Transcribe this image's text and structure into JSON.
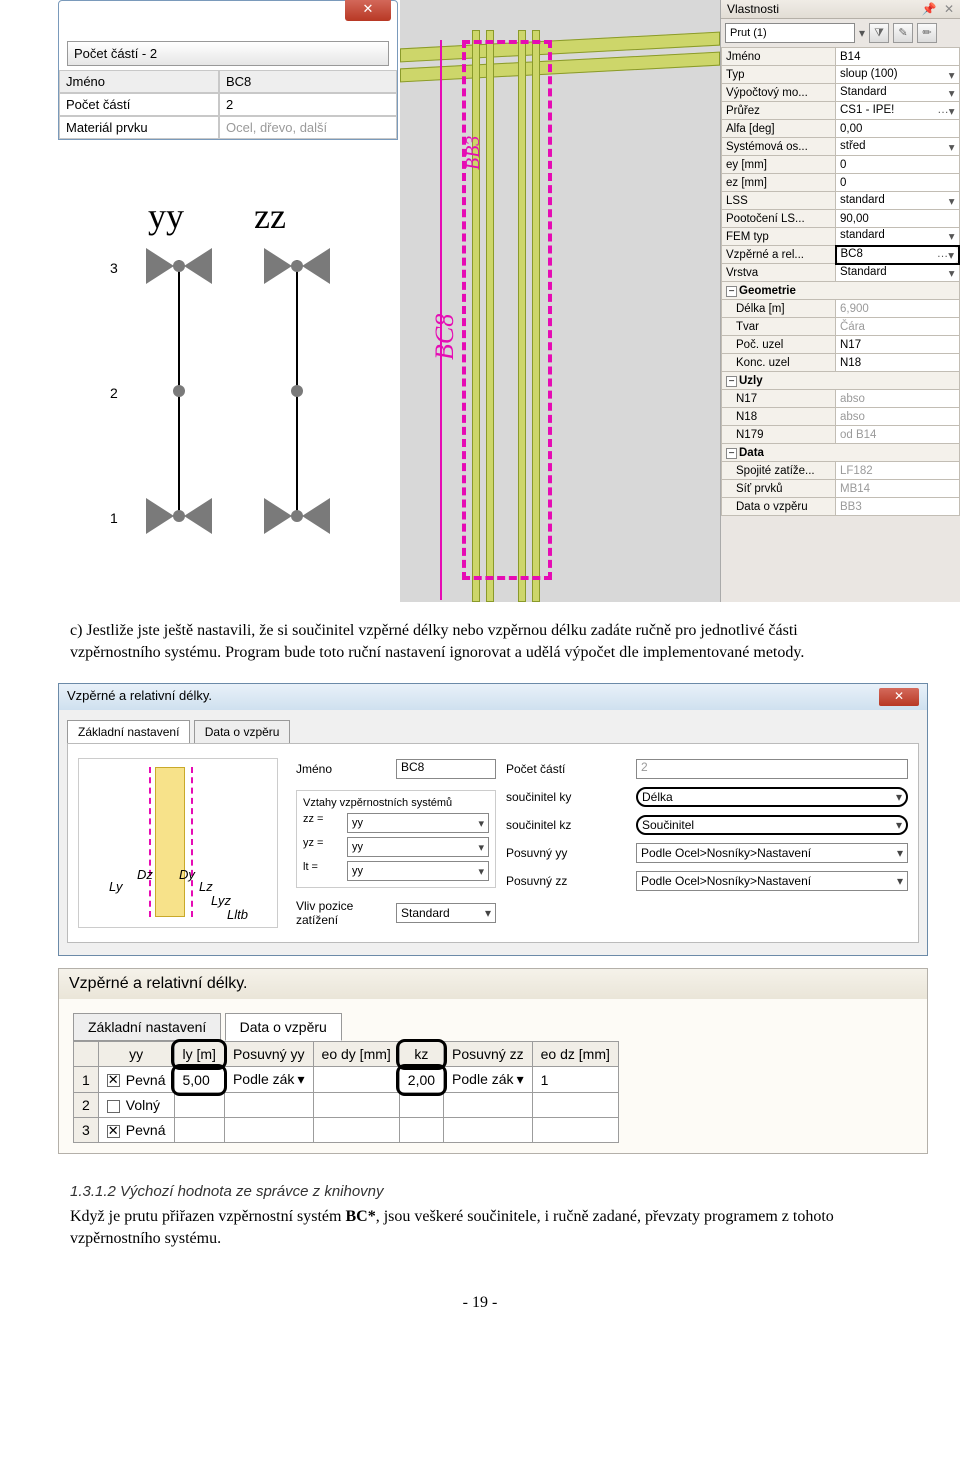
{
  "dialog_left": {
    "title": "Počet částí - 2",
    "rows": [
      {
        "label": "Jméno",
        "value": "BC8",
        "hdr": true
      },
      {
        "label": "Počet částí",
        "value": "2"
      },
      {
        "label": "Materiál prvku",
        "value": "Ocel, dřevo, další",
        "muted": true
      }
    ]
  },
  "yyzz": {
    "yy": "yy",
    "zz": "zz",
    "n1": "1",
    "n2": "2",
    "n3": "3"
  },
  "mid": {
    "label_bc8": "BC8",
    "label_bb3": "BB3"
  },
  "props": {
    "title": "Vlastnosti",
    "combo": "Prut (1)",
    "rows": [
      {
        "l": "Jméno",
        "v": "B14"
      },
      {
        "l": "Typ",
        "v": "sloup (100)",
        "dd": true
      },
      {
        "l": "Výpočtový mo...",
        "v": "Standard",
        "dd": true
      },
      {
        "l": "Průřez",
        "v": "CS1 - IPE!",
        "dd": true,
        "dots": true
      },
      {
        "l": "Alfa [deg]",
        "v": "0,00"
      },
      {
        "l": "Systémová os...",
        "v": "střed",
        "dd": true
      },
      {
        "l": "ey [mm]",
        "v": "0"
      },
      {
        "l": "ez [mm]",
        "v": "0"
      },
      {
        "l": "LSS",
        "v": "standard",
        "dd": true
      },
      {
        "l": "Pootočení LS...",
        "v": "90,00"
      },
      {
        "l": "FEM typ",
        "v": "standard",
        "dd": true
      },
      {
        "l": "Vzpěrné a rel...",
        "v": "BC8",
        "dd": true,
        "dots": true,
        "hl": true
      },
      {
        "l": "Vrstva",
        "v": "Standard",
        "dd": true
      }
    ],
    "sections": [
      {
        "l": "Geometrie",
        "rows": [
          {
            "l": "Délka [m]",
            "v": "6,900",
            "gray": true
          },
          {
            "l": "Tvar",
            "v": "Čára",
            "gray": true
          },
          {
            "l": "Poč. uzel",
            "v": "N17"
          },
          {
            "l": "Konc. uzel",
            "v": "N18"
          }
        ]
      },
      {
        "l": "Uzly",
        "rows": [
          {
            "l": "N17",
            "v": "abso",
            "gray": true
          },
          {
            "l": "N18",
            "v": "abso",
            "gray": true
          },
          {
            "l": "N179",
            "v": "od B14",
            "gray": true
          }
        ]
      },
      {
        "l": "Data",
        "rows": [
          {
            "l": "Spojité zatíže...",
            "v": "LF182",
            "gray": true
          },
          {
            "l": "Síť prvků",
            "v": "MB14",
            "gray": true
          },
          {
            "l": "Data o vzpěru",
            "v": "BB3",
            "gray": true
          }
        ]
      }
    ]
  },
  "doc": {
    "para_c": "c) Jestliže jste ještě nastavili, že si součinitel vzpěrné délky nebo vzpěrnou délku zadáte ručně pro jednotlivé části vzpěrnostního systému. Program bude toto ruční nastavení ignorovat a udělá výpočet dle implementované metody.",
    "sec_head": "1.3.1.2  Výchozí hodnota ze správce z knihovny",
    "para2a": "Když je prutu přiřazen vzpěrnostní systém ",
    "para2b": "BC*",
    "para2c": ", jsou veškeré součinitele, i ručně zadané, převzaty programem z tohoto vzpěrnostního systému.",
    "page_num": "- 19 -"
  },
  "dlg2": {
    "title": "Vzpěrné a relativní délky.",
    "tab1": "Základní nastavení",
    "tab2": "Data o vzpěru",
    "jmeno_l": "Jméno",
    "jmeno_v": "BC8",
    "pocet_l": "Počet částí",
    "pocet_v": "2",
    "grp": "Vztahy vzpěrnostních systémů",
    "zz_l": "zz =",
    "zz_v": "yy",
    "yz_l": "yz =",
    "yz_v": "yy",
    "lt_l": "lt =",
    "lt_v": "yy",
    "ky_l": "součinitel ky",
    "ky_v": "Délka",
    "kz_l": "součinitel kz",
    "kz_v": "Součinitel",
    "pyy_l": "Posuvný yy",
    "pyy_v": "Podle Ocel>Nosníky>Nastavení",
    "pzz_l": "Posuvný zz",
    "pzz_v": "Podle Ocel>Nosníky>Nastavení",
    "vliv_l": "Vliv pozice zatížení",
    "vliv_v": "Standard",
    "axes": {
      "Ly": "Ly",
      "Dz": "Dz",
      "Dy": "Dy",
      "Lz": "Lz",
      "Lyz": "Lyz",
      "Lltb": "Lltb"
    }
  },
  "dlg3": {
    "title": "Vzpěrné a relativní délky.",
    "tab1": "Základní nastavení",
    "tab2": "Data o vzpěru",
    "head": [
      "",
      "yy",
      "ly [m]",
      "Posuvný yy",
      "eo dy [mm]",
      "kz",
      "Posuvný zz",
      "eo dz [mm]"
    ],
    "rows": [
      {
        "n": "1",
        "yy": "Pevná",
        "yy_on": true,
        "ly": "5,00",
        "pyy": "Podle zák",
        "kz": "2,00",
        "pzz": "Podle zák",
        "edz": "1"
      },
      {
        "n": "2",
        "yy": "Volný",
        "yy_on": false
      },
      {
        "n": "3",
        "yy": "Pevná",
        "yy_on": true
      }
    ]
  }
}
